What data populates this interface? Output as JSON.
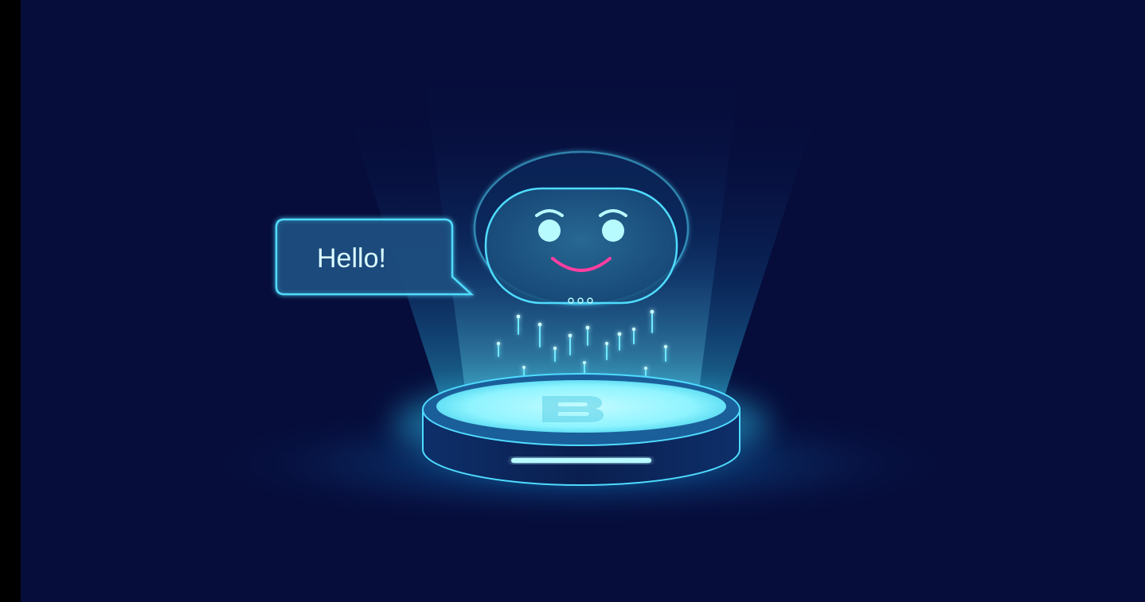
{
  "speech_bubble": {
    "text": "Hello!"
  },
  "colors": {
    "page_margin": "#000000",
    "background": "#060d3b",
    "glow": "#34d6ff",
    "outline": "#4fdcff",
    "pad_face": "#8ff4ff",
    "smile": "#ff3fa0",
    "eyes": "#b8fbff"
  },
  "icons": {
    "robot_face": "robot-head-icon",
    "platform": "hologram-projector",
    "logo": "letter-b-logo"
  }
}
